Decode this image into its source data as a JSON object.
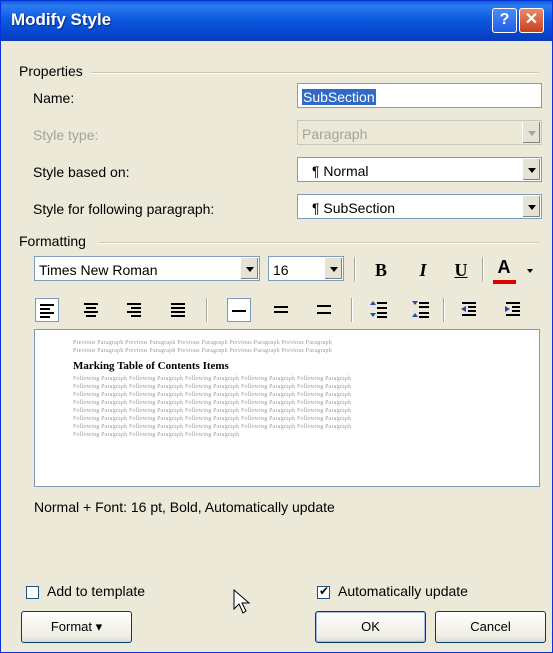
{
  "window": {
    "title": "Modify Style",
    "help_glyph": "?",
    "close_glyph": "✕"
  },
  "properties": {
    "group_label": "Properties",
    "name_label": "Name:",
    "name_value": "SubSection",
    "style_type_label": "Style type:",
    "style_type_value": "Paragraph",
    "based_on_label": "Style based on:",
    "based_on_value": "¶ Normal",
    "following_label": "Style for following paragraph:",
    "following_value": "¶ SubSection"
  },
  "formatting": {
    "group_label": "Formatting",
    "font_name": "Times New Roman",
    "font_size": "16",
    "bold": "B",
    "italic": "I",
    "underline": "U",
    "font_color_glyph": "A",
    "font_color_accent": "#e00000"
  },
  "preview": {
    "prev_line_1": "Previous Paragraph Previous Paragraph Previous Paragraph Previous Paragraph Previous Paragraph",
    "prev_line_2": "Previous Paragraph Previous Paragraph Previous Paragraph Previous Paragraph Previous Paragraph",
    "heading": "Marking Table of Contents Items",
    "follow_line": "Following Paragraph Following Paragraph Following Paragraph Following Paragraph Following Paragraph",
    "follow_line_last": "Following Paragraph Following Paragraph Following Paragraph"
  },
  "description": "Normal + Font: 16 pt, Bold, Automatically update",
  "options": {
    "add_to_template_label": "Add to template",
    "add_to_template_checked": false,
    "auto_update_label": "Automatically update",
    "auto_update_checked": true
  },
  "buttons": {
    "format_label": "Format ▾",
    "ok_label": "OK",
    "cancel_label": "Cancel"
  }
}
